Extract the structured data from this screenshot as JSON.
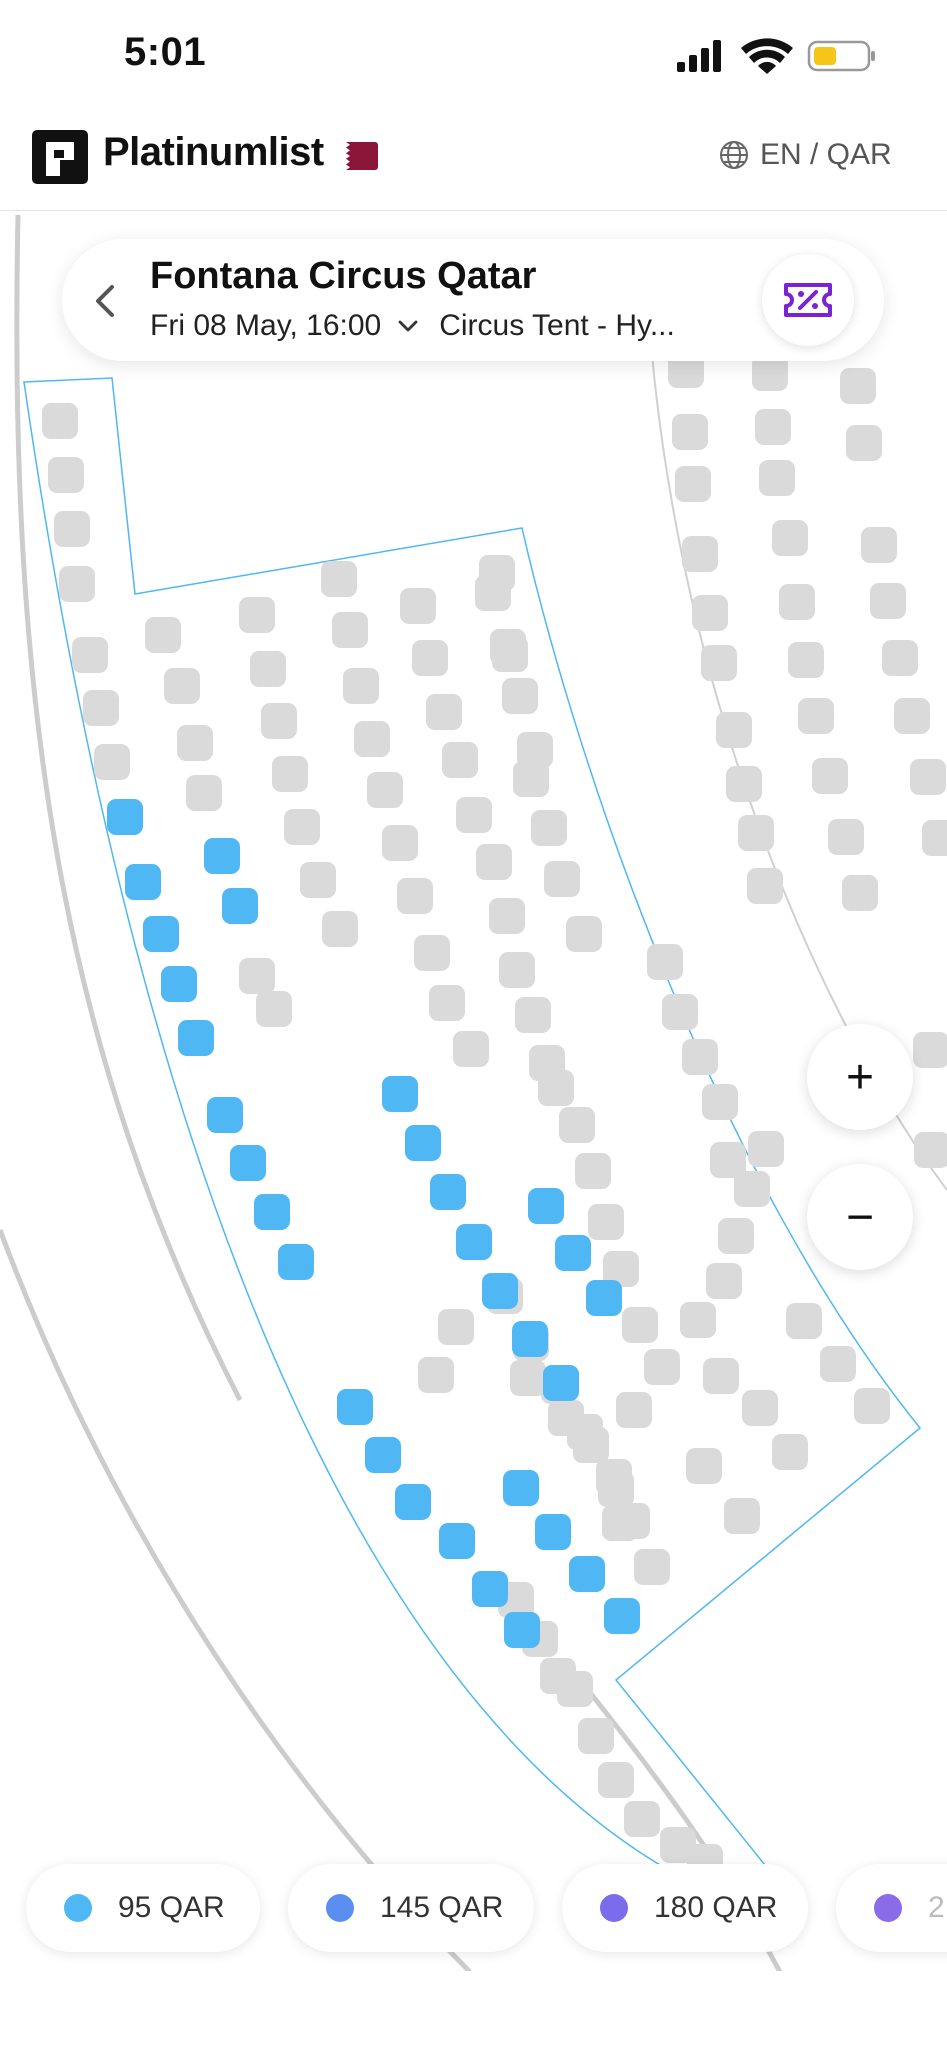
{
  "status_bar": {
    "time": "5:01"
  },
  "header": {
    "brand": "Platinumlist",
    "locale": "EN / QAR"
  },
  "event": {
    "title": "Fontana Circus Qatar",
    "date": "Fri 08 May, 16:00",
    "venue": "Circus Tent - Hy..."
  },
  "zoom": {
    "in_label": "+",
    "out_label": "−"
  },
  "legend": [
    {
      "label": "95 QAR",
      "color": "#4FB7F3"
    },
    {
      "label": "145 QAR",
      "color": "#5B8FEF"
    },
    {
      "label": "180 QAR",
      "color": "#7B6CEB"
    },
    {
      "label": "2",
      "color": "#8A6BEA"
    }
  ],
  "colors": {
    "seat_available": "#4FB7F3",
    "seat_unavailable": "#DADADA",
    "section_outline": "#4FB7F3",
    "ticket_icon": "#7B22D4"
  }
}
